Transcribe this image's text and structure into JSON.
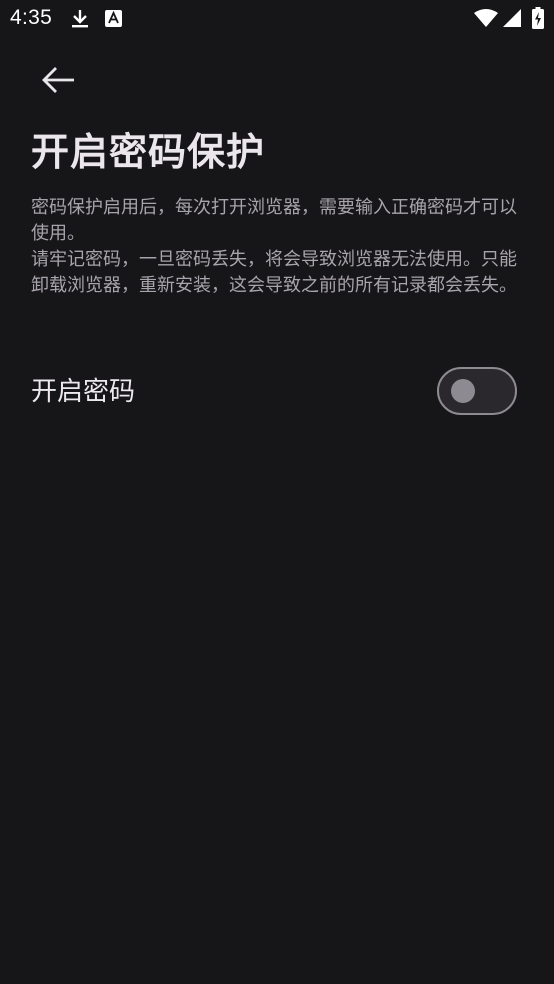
{
  "status_bar": {
    "time": "4:35",
    "icons": [
      "download-icon",
      "a-icon",
      "wifi-icon",
      "signal-icon",
      "battery-charging-icon"
    ]
  },
  "header": {
    "back_icon": "arrow-left-icon",
    "title": "开启密码保护"
  },
  "description": {
    "paragraph_1": "密码保护启用后，每次打开浏览器，需要输入正确密码才可以使用。",
    "paragraph_2": "请牢记密码，一旦密码丢失，将会导致浏览器无法使用。只能卸载浏览器，重新安装，这会导致之前的所有记录都会丢失。"
  },
  "setting": {
    "label": "开启密码",
    "enabled": false
  },
  "colors": {
    "background": "#161517",
    "title": "#eae6ec",
    "description": "#a8a4ab",
    "toggle_off": "#8e8a91"
  }
}
